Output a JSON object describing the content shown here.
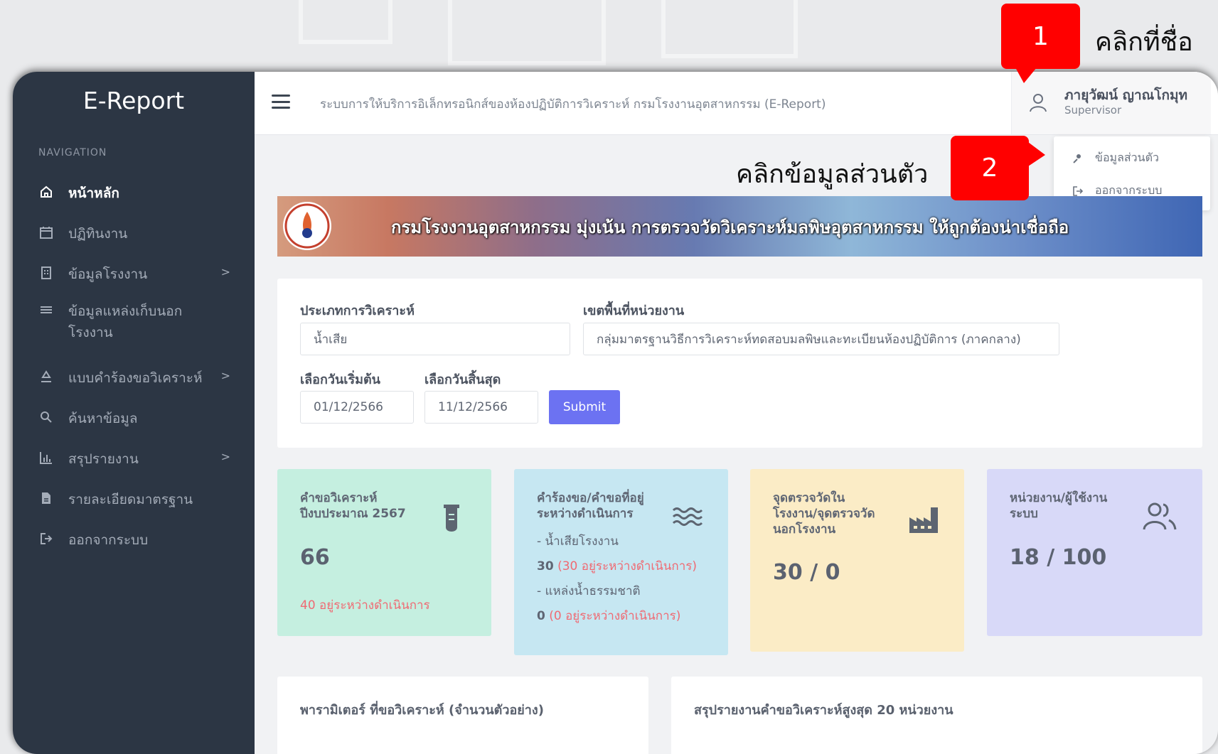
{
  "app": {
    "brand": "E-Report",
    "top_title": "ระบบการให้บริการอิเล็กทรอนิกส์ของห้องปฏิบัติการวิเคราะห์ กรมโรงงานอุตสาหกรรม (E-Report)"
  },
  "sidebar": {
    "caption": "NAVIGATION",
    "items": [
      {
        "label": "หน้าหลัก",
        "icon": "home-icon",
        "active": true
      },
      {
        "label": "ปฏิทินงาน",
        "icon": "calendar-icon"
      },
      {
        "label": "ข้อมูลโรงงาน",
        "icon": "building-icon",
        "chevron": ">"
      },
      {
        "label": "ข้อมูลแหล่งเก็บนอกโรงงาน",
        "icon": "waves-icon"
      },
      {
        "label": "แบบคำร้องขอวิเคราะห์",
        "icon": "recycle-icon",
        "chevron": ">"
      },
      {
        "label": "ค้นหาข้อมูล",
        "icon": "search-icon"
      },
      {
        "label": "สรุปรายงาน",
        "icon": "bar-chart-icon",
        "chevron": ">"
      },
      {
        "label": "รายละเอียดมาตรฐาน",
        "icon": "document-icon"
      },
      {
        "label": "ออกจากระบบ",
        "icon": "logout-icon"
      }
    ]
  },
  "user": {
    "name": "ภายุวัฒน์ ญาณโกมุท",
    "role": "Supervisor"
  },
  "dropdown": {
    "profile": "ข้อมูลส่วนตัว",
    "logout": "ออกจากระบบ"
  },
  "banner": {
    "text": "กรมโรงงานอุตสาหกรรม มุ่งเน้น การตรวจวัดวิเคราะห์มลพิษอุตสาหกรรม ให้ถูกต้องน่าเชื่อถือ"
  },
  "filter": {
    "type_label": "ประเภทการวิเคราะห์",
    "type_value": "น้ำเสีย",
    "area_label": "เขตพื้นที่หน่วยงาน",
    "area_value": "กลุ่มมาตรฐานวิธีการวิเคราะห์ทดสอบมลพิษและทะเบียนห้องปฏิบัติการ (ภาคกลาง)",
    "start_label": "เลือกวันเริ่มต้น",
    "start_value": "01/12/2566",
    "end_label": "เลือกวันสิ้นสุด",
    "end_value": "11/12/2566",
    "submit": "Submit"
  },
  "stats": {
    "card1": {
      "title1": "คำขอวิเคราะห์",
      "title2": "ปีงบประมาณ 2567",
      "value": "66",
      "sub": "40 อยู่ระหว่างดำเนินการ",
      "color": "#c5efe0"
    },
    "card2": {
      "title1": "คำร้องขอ/คำขอที่อยู่",
      "title2": "ระหว่างดำเนินการ",
      "line1": "- น้ำเสียโรงงาน",
      "v1": "30",
      "v1_note": "(30 อยู่ระหว่างดำเนินการ)",
      "line2": "- แหล่งน้ำธรรมชาติ",
      "v2": "0",
      "v2_note": "(0 อยู่ระหว่างดำเนินการ)",
      "color": "#c6e7f2"
    },
    "card3": {
      "title1": "จุดตรวจวัดใน",
      "title2": "โรงงาน/จุดตรวจวัด",
      "title3": "นอกโรงงาน",
      "value": "30 / 0",
      "color": "#fbecc6"
    },
    "card4": {
      "title1": "หน่วยงาน/ผู้ใช้งาน",
      "title2": "ระบบ",
      "value": "18 / 100",
      "color": "#d8d9f8"
    }
  },
  "bottom": {
    "left_title": "พารามิเตอร์ ที่ขอวิเคราะห์ (จำนวนตัวอย่าง)",
    "right_title": "สรุปรายงานคำขอวิเคราะห์สูงสุด 20 หน่วยงาน"
  },
  "annotations": {
    "step1_num": "1",
    "step1_text": "คลิกที่ชื่อ",
    "step2_num": "2",
    "step2_text": "คลิกข้อมูลส่วนตัว"
  }
}
